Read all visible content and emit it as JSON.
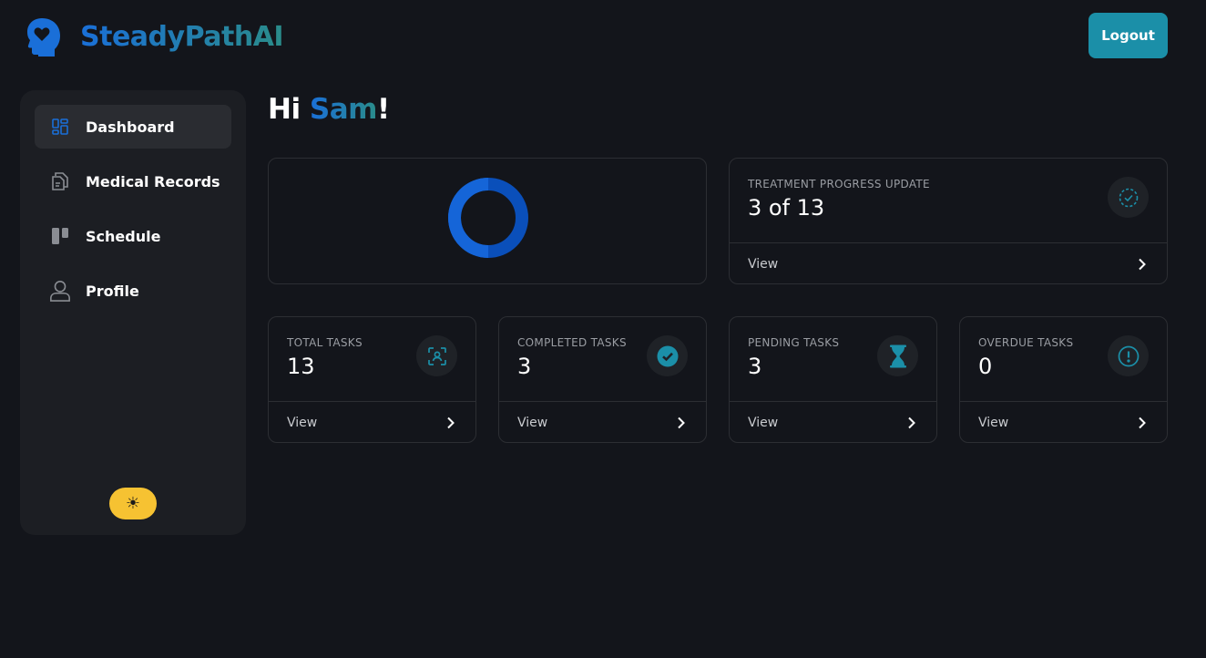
{
  "header": {
    "brand": "SteadyPathAI",
    "logout_label": "Logout"
  },
  "sidebar": {
    "items": [
      {
        "label": "Dashboard",
        "icon": "dashboard-icon",
        "active": true
      },
      {
        "label": "Medical Records",
        "icon": "documents-icon",
        "active": false
      },
      {
        "label": "Schedule",
        "icon": "kanban-icon",
        "active": false
      },
      {
        "label": "Profile",
        "icon": "user-icon",
        "active": false
      }
    ],
    "theme_toggle_icon": "sun-icon"
  },
  "main": {
    "greeting_prefix": "Hi ",
    "greeting_name": "Sam",
    "greeting_suffix": "!",
    "progress_chart": {
      "completed": 3,
      "total": 13
    },
    "progress": {
      "title": "TREATMENT PROGRESS UPDATE",
      "value": "3 of 13",
      "view_label": "View",
      "icon": "check-circle-dashed-icon"
    },
    "tasks": [
      {
        "title": "TOTAL TASKS",
        "value": "13",
        "view_label": "View",
        "icon": "scan-user-icon"
      },
      {
        "title": "COMPLETED TASKS",
        "value": "3",
        "view_label": "View",
        "icon": "check-circle-icon"
      },
      {
        "title": "PENDING TASKS",
        "value": "3",
        "view_label": "View",
        "icon": "hourglass-icon"
      },
      {
        "title": "OVERDUE TASKS",
        "value": "0",
        "view_label": "View",
        "icon": "alert-circle-icon"
      }
    ]
  },
  "colors": {
    "background": "#13151b",
    "sidebar": "#1c1e23",
    "accent_blue": "#1a6fd8",
    "accent_teal": "#1b8fa8",
    "donut_light": "#1565d8",
    "donut_dark": "#0a4fba",
    "theme_toggle": "#f6c232"
  }
}
